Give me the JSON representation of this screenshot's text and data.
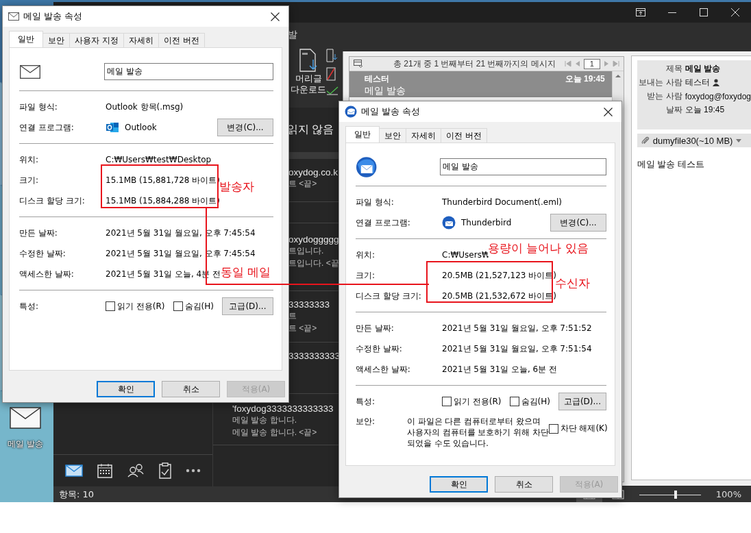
{
  "desktop": {
    "icon_label": "메일 발송"
  },
  "outlook": {
    "ribbon_fragment": "발",
    "download_button": "머리글\n다운로드",
    "filter_label": "읽지 않음",
    "messages": [
      {
        "lines": [
          "oxydog.co.k",
          "트 <끝>"
        ]
      },
      {
        "lines": [
          "oxydoggggg",
          "트입니다.",
          "트입니다. <끝"
        ]
      },
      {
        "lines": [
          "33333333",
          "트",
          "트 <끝>"
        ]
      },
      {
        "lines": [
          "3333333333"
        ]
      },
      {
        "lines": [
          "'foxydog3333333333333",
          "메일 발송 합니다.",
          "메일 발송 합니다. <끝>"
        ]
      }
    ],
    "nav": [
      {
        "kind": "mail",
        "selected": true
      },
      {
        "kind": "calendar",
        "selected": false
      },
      {
        "kind": "people",
        "selected": false
      },
      {
        "kind": "tasks",
        "selected": false
      },
      {
        "kind": "more",
        "selected": false
      }
    ],
    "status": "항목: 10",
    "zoom_slider": {
      "level": 0.6
    },
    "zoom": "100%"
  },
  "viewer": {
    "list_header": "총 21개 중 1 번째부터 21 번째까지의 메시지",
    "page": "1",
    "message": {
      "sender": "테스터",
      "time": "오늘 19:45",
      "subject": "메일 발송",
      "selected": true
    },
    "header_fields": [
      {
        "label": "제목",
        "value": "메일 발송",
        "kind": "subject"
      },
      {
        "label": "보내는 사람",
        "value": "테스터",
        "kind": "contact"
      },
      {
        "label": "받는 사람",
        "value": "foxydog@foxydog",
        "kind": "text"
      },
      {
        "label": "날짜",
        "value": "오늘 19:45",
        "kind": "text"
      }
    ],
    "attachment": "dumyfile30(~10 MB)",
    "body": "메일 발송 테스트"
  },
  "dialogs": [
    {
      "title": "메일 발송 속성",
      "tabs": [
        {
          "label": "일반",
          "selected": true
        },
        {
          "label": "보안",
          "selected": false
        },
        {
          "label": "사용자 지정",
          "selected": false
        },
        {
          "label": "자세히",
          "selected": false
        },
        {
          "label": "이전 버전",
          "selected": false
        }
      ],
      "name": "메일 발송",
      "sections": [
        [
          {
            "label": "파일 형식:",
            "value": "Outlook 항목(.msg)",
            "kind": "text"
          },
          {
            "label": "연결 프로그램:",
            "value": "Outlook",
            "kind": "app",
            "button": "변경(C)..."
          }
        ],
        [
          {
            "label": "위치:",
            "value": "C:₩Users₩test₩Desktop",
            "kind": "text"
          },
          {
            "label": "크기:",
            "value": "15.1MB (15,881,728 바이트)",
            "kind": "text"
          },
          {
            "label": "디스크 할당 크기:",
            "value": "15.1MB (15,884,288 바이트)",
            "kind": "text"
          }
        ],
        [
          {
            "label": "만든 날짜:",
            "value": "2021년 5월 31일 월요일, 오후 7:45:54",
            "kind": "text"
          },
          {
            "label": "수정한 날짜:",
            "value": "2021년 5월 31일 월요일, 오후 7:45:54",
            "kind": "text"
          },
          {
            "label": "액세스한 날짜:",
            "value": "2021년 5월 31일 오늘, 4분 전",
            "kind": "text"
          }
        ]
      ],
      "attributes_label": "특성:",
      "attributes": [
        {
          "label": "읽기 전용(R)",
          "checked": false
        },
        {
          "label": "숨김(H)",
          "checked": false
        }
      ],
      "advanced_button": "고급(D)...",
      "buttons": [
        {
          "label": "확인",
          "kind": "default",
          "disabled": false
        },
        {
          "label": "취소",
          "kind": "normal",
          "disabled": false
        },
        {
          "label": "적용(A)",
          "kind": "normal",
          "disabled": true
        }
      ]
    },
    {
      "title": "메일 발송 속성",
      "tabs": [
        {
          "label": "일반",
          "selected": true
        },
        {
          "label": "보안",
          "selected": false
        },
        {
          "label": "자세히",
          "selected": false
        },
        {
          "label": "이전 버전",
          "selected": false
        }
      ],
      "name": "메일 발송",
      "sections": [
        [
          {
            "label": "파일 형식:",
            "value": "Thunderbird Document(.eml)",
            "kind": "text"
          },
          {
            "label": "연결 프로그램:",
            "value": "Thunderbird",
            "kind": "app",
            "button": "변경(C)..."
          }
        ],
        [
          {
            "label": "위치:",
            "value": "C:₩Users₩",
            "kind": "text"
          },
          {
            "label": "크기:",
            "value": "20.5MB (21,527,123 바이트)",
            "kind": "text"
          },
          {
            "label": "디스크 할당 크기:",
            "value": "20.5MB (21,532,672 바이트)",
            "kind": "text"
          }
        ],
        [
          {
            "label": "만든 날짜:",
            "value": "2021년 5월 31일 월요일, 오후 7:51:52",
            "kind": "text"
          },
          {
            "label": "수정한 날짜:",
            "value": "2021년 5월 31일 월요일, 오후 7:51:54",
            "kind": "text"
          },
          {
            "label": "액세스한 날짜:",
            "value": "2021년 5월 31일 오늘, 6분 전",
            "kind": "text"
          }
        ]
      ],
      "attributes_label": "특성:",
      "attributes": [
        {
          "label": "읽기 전용(R)",
          "checked": false
        },
        {
          "label": "숨김(H)",
          "checked": false
        }
      ],
      "advanced_button": "고급(D)...",
      "security": {
        "label": "보안:",
        "text": "이 파일은 다른 컴퓨터로부터 왔으며\n사용자의 컴퓨터를 보호하기 위해 차단\n되었을 수도 있습니다.",
        "unblock": {
          "label": "차단 해제(K)",
          "checked": false
        }
      },
      "buttons": [
        {
          "label": "확인",
          "kind": "default",
          "disabled": false
        },
        {
          "label": "취소",
          "kind": "normal",
          "disabled": false
        },
        {
          "label": "적용(A)",
          "kind": "normal",
          "disabled": true
        }
      ]
    }
  ],
  "annotations": [
    {
      "text": "발송자"
    },
    {
      "text": "동일 메일"
    },
    {
      "text": "수신자"
    },
    {
      "text": "용량이 늘어나 있음"
    }
  ]
}
